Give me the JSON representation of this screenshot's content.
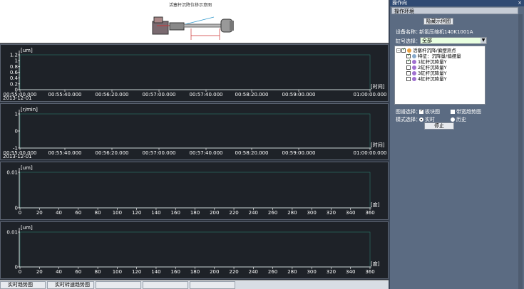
{
  "diagram": {
    "title": "活塞杆沉降位移示意图"
  },
  "charts": {
    "c1": {
      "unit_y": "[um]",
      "unit_x": "[时间]",
      "yticks": [
        "1.2",
        "1",
        "0.8",
        "0.6",
        "0.4",
        "0.2",
        "0"
      ],
      "xticks": [
        "00:55:00.000",
        "00:55:40.000",
        "00:56:20.000",
        "00:57:00.000",
        "00:57:40.000",
        "00:58:20.000",
        "00:59:00.000",
        "01:00:00.000"
      ],
      "date": "2013-12-01"
    },
    "c2": {
      "unit_y": "[r/min]",
      "unit_x": "[时间]",
      "yticks": [
        "1",
        "0",
        "-1"
      ],
      "xticks": [
        "00:55:00.000",
        "00:55:40.000",
        "00:56:20.000",
        "00:57:00.000",
        "00:57:40.000",
        "00:58:20.000",
        "00:59:00.000",
        "01:00:00.000"
      ],
      "date": "2013-12-01"
    },
    "c3": {
      "unit_y": "[um]",
      "unit_x": "[度]",
      "yticks": [
        "0.01",
        "0"
      ],
      "xticks": [
        "0",
        "20",
        "40",
        "60",
        "80",
        "100",
        "120",
        "140",
        "160",
        "180",
        "200",
        "220",
        "240",
        "260",
        "280",
        "300",
        "320",
        "340",
        "360"
      ]
    },
    "c4": {
      "unit_y": "[um]",
      "unit_x": "[度]",
      "yticks": [
        "0.01",
        "0"
      ],
      "xticks": [
        "0",
        "20",
        "40",
        "60",
        "80",
        "100",
        "120",
        "140",
        "160",
        "180",
        "200",
        "220",
        "240",
        "260",
        "280",
        "300",
        "320",
        "340",
        "360"
      ]
    }
  },
  "tabs": [
    "实时趋势图",
    "实时转速趋势图"
  ],
  "right": {
    "title": "操作向",
    "close": "×",
    "tab": "操作环境",
    "hide_btn": "隐藏示例图",
    "device_label": "设备名称：",
    "device_value": "新氢压缩机140K1001A",
    "cylinder_label": "缸号选择：",
    "cylinder_value": "全部",
    "tree": [
      {
        "label": "活塞杆沉降/偏摆测点",
        "level": 1,
        "checked": true,
        "icon": "#e8a040"
      },
      {
        "label": "特征：沉降量/偏摆量",
        "level": 2,
        "checked": true,
        "icon": "#9bc"
      },
      {
        "label": "1缸杆沉降量Y",
        "level": 2,
        "checked": true,
        "icon": "#a070d0"
      },
      {
        "label": "2缸杆沉降量Y",
        "level": 2,
        "checked": false,
        "icon": "#a070d0"
      },
      {
        "label": "3缸杆沉降量Y",
        "level": 2,
        "checked": false,
        "icon": "#a070d0"
      },
      {
        "label": "4缸杆沉降量Y",
        "level": 2,
        "checked": false,
        "icon": "#a070d0"
      }
    ],
    "graph_label": "图谱选择：",
    "graph_opt1": "板块图",
    "graph_opt2": "带宽趋势图",
    "mode_label": "模式选择：",
    "mode_opt1": "实时",
    "mode_opt2": "历史",
    "stop_btn": "停止"
  }
}
